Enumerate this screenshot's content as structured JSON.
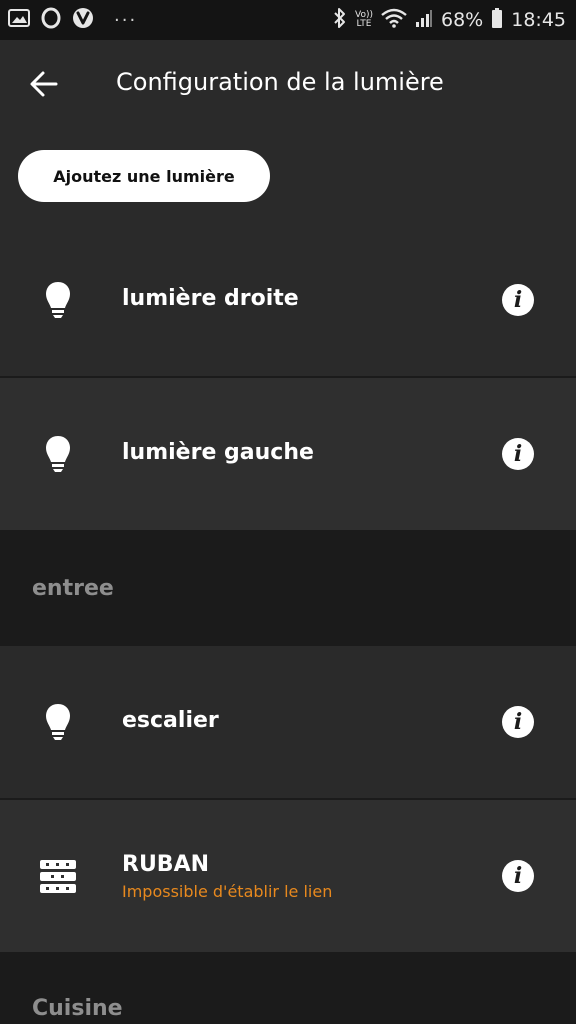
{
  "status_bar": {
    "battery_percent": "68%",
    "time": "18:45",
    "volte_top": "Vo))",
    "volte_bottom": "LTE",
    "dots": "···"
  },
  "header": {
    "title": "Configuration de la lumière",
    "back_icon": "arrow-left-icon"
  },
  "add_button": {
    "label": "Ajoutez une lumière"
  },
  "lights": [
    {
      "name": "lumière droite",
      "icon": "bulb-icon"
    },
    {
      "name": "lumière gauche",
      "icon": "bulb-icon"
    }
  ],
  "sections": [
    {
      "title": "entree",
      "lights": [
        {
          "name": "escalier",
          "icon": "bulb-icon"
        },
        {
          "name": "RUBAN",
          "icon": "lightstrip-icon",
          "status": "Impossible d'établir le lien"
        }
      ]
    },
    {
      "title": "Cuisine"
    }
  ],
  "colors": {
    "background": "#1b1b1b",
    "row": "#2a2a2a",
    "row_alt": "#2f2f2f",
    "error": "#e8891e",
    "section_label": "#8e8e8e"
  }
}
